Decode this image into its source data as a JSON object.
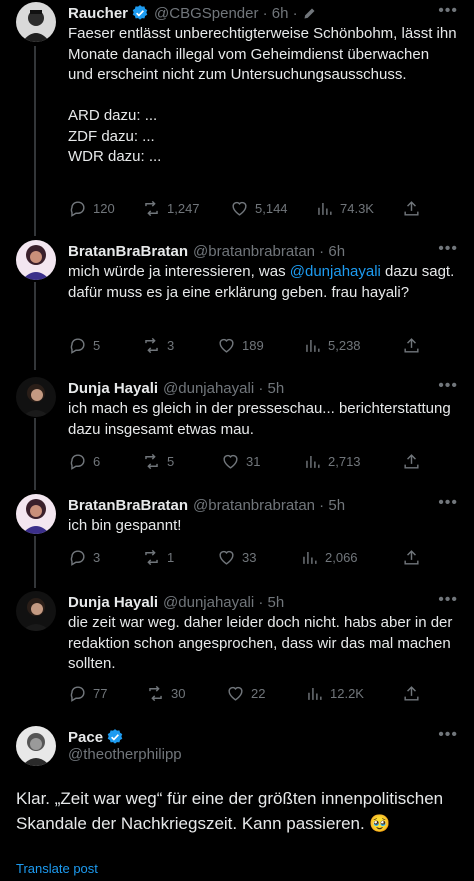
{
  "tweets": [
    {
      "name": "Raucher",
      "handle": "@CBGSpender · 6h ·",
      "text": "Faeser entlässt unberechtigterweise Schönbohm, lässt ihn Monate danach illegal vom Geheimdienst überwachen und erscheint nicht zum Untersuchungsausschuss.\n\nARD dazu: ...\nZDF dazu: ...\nWDR dazu: ...",
      "replies": "120",
      "reposts": "1,247",
      "likes": "5,144",
      "views": "74.3K"
    },
    {
      "name": "BratanBraBratan",
      "handle": "@bratanbrabratan · 6h",
      "text_before": "mich würde ja interessieren, was ",
      "mention": "@dunjahayali",
      "text_after": " dazu sagt. dafür muss es ja eine erklärung geben. frau hayali?",
      "replies": "5",
      "reposts": "3",
      "likes": "189",
      "views": "5,238"
    },
    {
      "name": "Dunja Hayali",
      "handle": "@dunjahayali · 5h",
      "text": "ich mach es gleich in der presseschau... berichterstattung dazu insgesamt etwas mau.",
      "replies": "6",
      "reposts": "5",
      "likes": "31",
      "views": "2,713"
    },
    {
      "name": "BratanBraBratan",
      "handle": "@bratanbrabratan · 5h",
      "text": "ich bin gespannt!",
      "replies": "3",
      "reposts": "1",
      "likes": "33",
      "views": "2,066"
    },
    {
      "name": "Dunja Hayali",
      "handle": "@dunjahayali · 5h",
      "text": "die zeit war weg. daher leider doch nicht. habs aber in der redaktion schon angesprochen, dass wir das mal machen sollten.",
      "replies": "77",
      "reposts": "30",
      "likes": "22",
      "views": "12.2K"
    }
  ],
  "main_post": {
    "name": "Pace",
    "handle": "@theotherphilipp",
    "text": "Klar. „Zeit war weg“ für eine der größten innenpolitischen Skandale der Nachkriegszeit. Kann passieren. 🥹",
    "translate": "Translate post"
  },
  "more_glyph": "•••",
  "colors": {
    "accent": "#1d9bf0",
    "muted": "#71767b",
    "background": "#000000"
  }
}
